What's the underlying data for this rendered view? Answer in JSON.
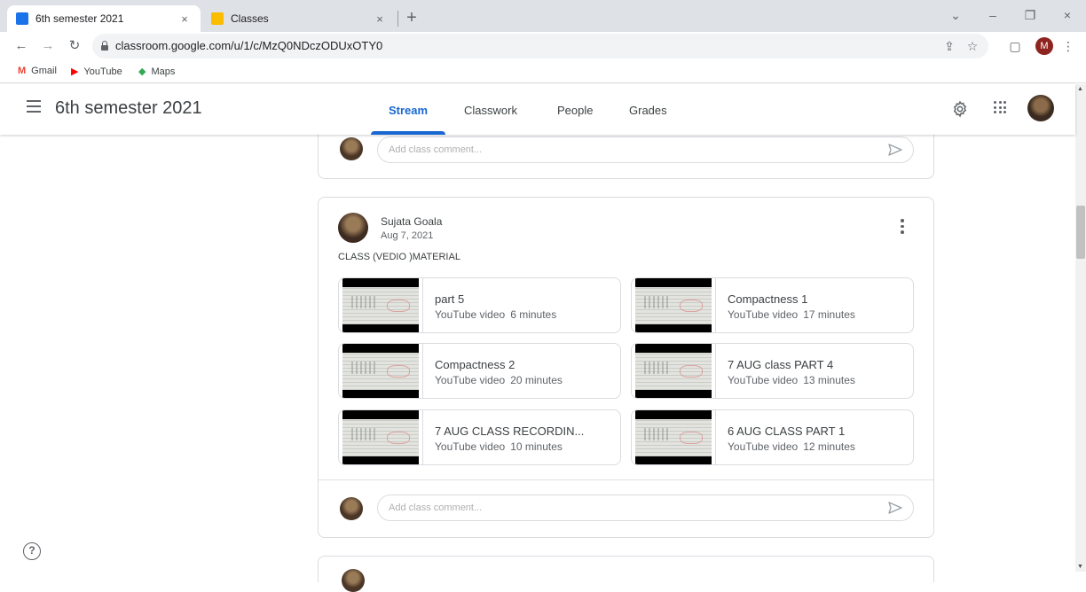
{
  "browser": {
    "tabs": [
      {
        "title": "6th semester 2021",
        "favicon_color": "#1a73e8",
        "close": "×"
      },
      {
        "title": "Classes",
        "favicon_color": "#fbbc04",
        "close": "×"
      }
    ],
    "new_tab": "+",
    "window_controls": {
      "chevron": "⌄",
      "minimize": "–",
      "restore": "❐",
      "close": "×"
    },
    "nav": {
      "back": "←",
      "forward": "→",
      "reload": "↻"
    },
    "url": "classroom.google.com/u/1/c/MzQ0NDczODUxOTY0",
    "toolbar_icons": {
      "share": "⇪",
      "star": "☆",
      "sidepanel": "▢",
      "menu": "⋮"
    },
    "profile_initial": "M",
    "bookmarks": [
      {
        "label": "Gmail",
        "icon": "M",
        "color": "#ea4335"
      },
      {
        "label": "YouTube",
        "icon": "▶",
        "color": "#ff0000"
      },
      {
        "label": "Maps",
        "icon": "◆",
        "color": "#34a853"
      }
    ]
  },
  "classroom": {
    "class_name": "6th semester 2021",
    "nav_tabs": [
      "Stream",
      "Classwork",
      "People",
      "Grades"
    ],
    "accent": "#1967d2"
  },
  "comments": {
    "placeholder": "Add class comment..."
  },
  "post": {
    "author": "Sujata Goala",
    "date": "Aug 7, 2021",
    "text": "CLASS (VEDIO )MATERIAL",
    "attachments": [
      {
        "title": "part 5",
        "type": "YouTube video",
        "duration": "6 minutes"
      },
      {
        "title": "Compactness 1",
        "type": "YouTube video",
        "duration": "17 minutes"
      },
      {
        "title": "Compactness 2",
        "type": "YouTube video",
        "duration": "20 minutes"
      },
      {
        "title": "7 AUG class PART 4",
        "type": "YouTube video",
        "duration": "13 minutes"
      },
      {
        "title": "7 AUG CLASS RECORDIN...",
        "type": "YouTube video",
        "duration": "10 minutes"
      },
      {
        "title": "6 AUG CLASS PART 1",
        "type": "YouTube video",
        "duration": "12 minutes"
      }
    ]
  },
  "help": "?"
}
